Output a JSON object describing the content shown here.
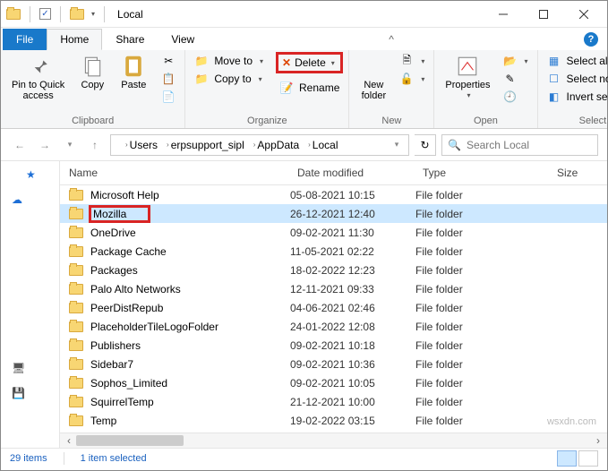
{
  "window": {
    "title": "Local"
  },
  "tabs": {
    "file": "File",
    "home": "Home",
    "share": "Share",
    "view": "View"
  },
  "ribbon": {
    "clipboard": {
      "label": "Clipboard",
      "pin": "Pin to Quick\naccess",
      "copy": "Copy",
      "paste": "Paste"
    },
    "organize": {
      "label": "Organize",
      "moveto": "Move to",
      "copyto": "Copy to",
      "delete": "Delete",
      "rename": "Rename"
    },
    "new": {
      "label": "New",
      "newfolder": "New\nfolder"
    },
    "open": {
      "label": "Open",
      "properties": "Properties"
    },
    "select": {
      "label": "Select",
      "all": "Select all",
      "none": "Select none",
      "invert": "Invert selection"
    }
  },
  "breadcrumb": {
    "items": [
      "Users",
      "erpsupport_sipl",
      "AppData",
      "Local"
    ]
  },
  "search": {
    "placeholder": "Search Local"
  },
  "columns": {
    "name": "Name",
    "date": "Date modified",
    "type": "Type",
    "size": "Size"
  },
  "files": [
    {
      "name": "Microsoft Help",
      "date": "05-08-2021 10:15",
      "type": "File folder",
      "selected": false
    },
    {
      "name": "Mozilla",
      "date": "26-12-2021 12:40",
      "type": "File folder",
      "selected": true,
      "highlight": true
    },
    {
      "name": "OneDrive",
      "date": "09-02-2021 11:30",
      "type": "File folder",
      "selected": false
    },
    {
      "name": "Package Cache",
      "date": "11-05-2021 02:22",
      "type": "File folder",
      "selected": false
    },
    {
      "name": "Packages",
      "date": "18-02-2022 12:23",
      "type": "File folder",
      "selected": false
    },
    {
      "name": "Palo Alto Networks",
      "date": "12-11-2021 09:33",
      "type": "File folder",
      "selected": false
    },
    {
      "name": "PeerDistRepub",
      "date": "04-06-2021 02:46",
      "type": "File folder",
      "selected": false
    },
    {
      "name": "PlaceholderTileLogoFolder",
      "date": "24-01-2022 12:08",
      "type": "File folder",
      "selected": false
    },
    {
      "name": "Publishers",
      "date": "09-02-2021 10:18",
      "type": "File folder",
      "selected": false
    },
    {
      "name": "Sidebar7",
      "date": "09-02-2021 10:36",
      "type": "File folder",
      "selected": false
    },
    {
      "name": "Sophos_Limited",
      "date": "09-02-2021 10:05",
      "type": "File folder",
      "selected": false
    },
    {
      "name": "SquirrelTemp",
      "date": "21-12-2021 10:00",
      "type": "File folder",
      "selected": false
    },
    {
      "name": "Temp",
      "date": "19-02-2022 03:15",
      "type": "File folder",
      "selected": false
    }
  ],
  "status": {
    "items": "29 items",
    "selected": "1 item selected"
  },
  "watermark": "wsxdn.com"
}
